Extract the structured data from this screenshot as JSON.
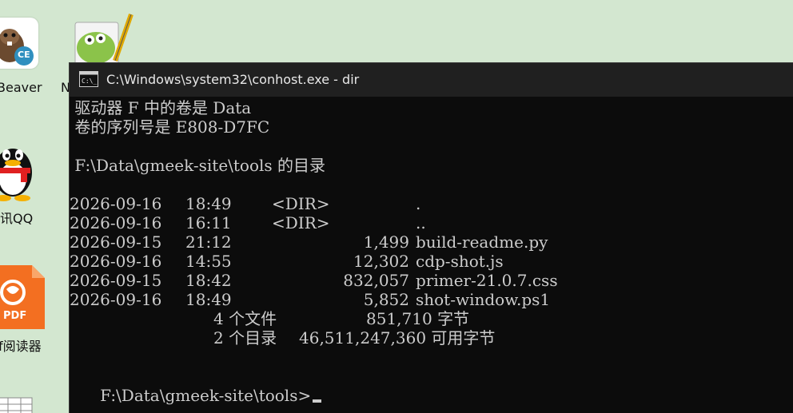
{
  "desktop": {
    "icons": [
      {
        "label": "Beaver",
        "badge": "CE"
      },
      {
        "label": "N"
      },
      {
        "label": "讯QQ"
      },
      {
        "label": "PDF",
        "caption": "f阅读器"
      }
    ]
  },
  "window": {
    "title": "C:\\Windows\\system32\\conhost.exe - dir"
  },
  "console": {
    "volume_line": " 驱动器 F 中的卷是 Data",
    "serial_line": " 卷的序列号是 E808-D7FC",
    "dir_line": " F:\\Data\\gmeek-site\\tools 的目录",
    "entries": [
      {
        "date": "2026-09-16",
        "time": "18:49",
        "dir": "<DIR>",
        "size": "",
        "name": "."
      },
      {
        "date": "2026-09-16",
        "time": "16:11",
        "dir": "<DIR>",
        "size": "",
        "name": ".."
      },
      {
        "date": "2026-09-15",
        "time": "21:12",
        "dir": "",
        "size": "1,499",
        "name": "build-readme.py"
      },
      {
        "date": "2026-09-16",
        "time": "14:55",
        "dir": "",
        "size": "12,302",
        "name": "cdp-shot.js"
      },
      {
        "date": "2026-09-15",
        "time": "18:42",
        "dir": "",
        "size": "832,057",
        "name": "primer-21.0.7.css"
      },
      {
        "date": "2026-09-16",
        "time": "18:49",
        "dir": "",
        "size": "5,852",
        "name": "shot-window.ps1"
      }
    ],
    "files_summary": {
      "count": "4 个文件",
      "bytes": "851,710 字节"
    },
    "dirs_summary": {
      "count": "2 个目录",
      "bytes": "46,511,247,360 可用字节"
    },
    "prompt": "F:\\Data\\gmeek-site\\tools>"
  }
}
